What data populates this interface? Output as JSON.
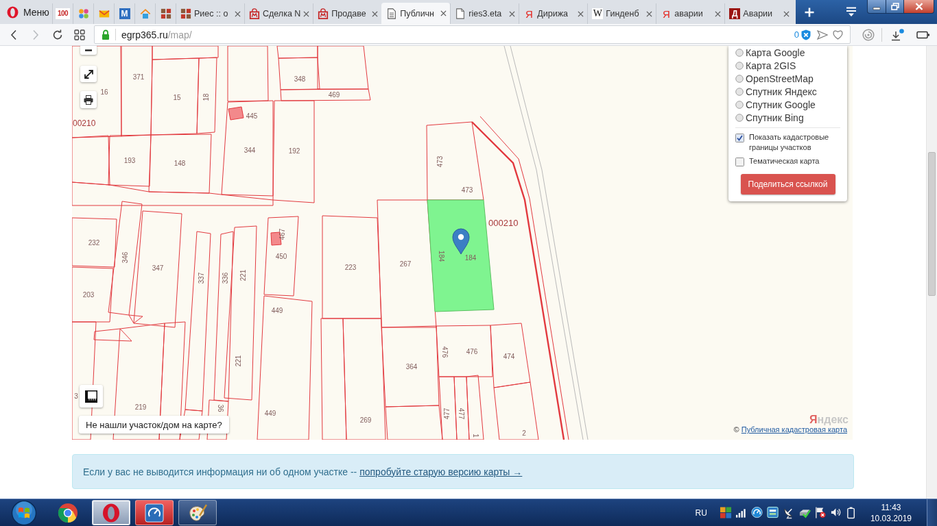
{
  "browser": {
    "menu": "Меню",
    "tabs": [
      {
        "icon_text": "100",
        "selected": false
      },
      {
        "selected": false
      },
      {
        "selected": false
      },
      {
        "icon_text": "M",
        "selected": false
      },
      {
        "selected": false
      },
      {
        "selected": false
      },
      {
        "label": "Риес :: о",
        "selected": false
      },
      {
        "label": "Сделка N",
        "selected": false
      },
      {
        "label": "Продаве",
        "selected": false
      },
      {
        "label": "Публичн",
        "selected": true
      },
      {
        "label": "ries3.eta",
        "selected": false
      },
      {
        "icon_text": "Я",
        "label": "Дирижа",
        "selected": false
      },
      {
        "icon_text": "W",
        "label": "Гинденб",
        "selected": false
      },
      {
        "icon_text": "Я",
        "label": "аварии",
        "selected": false
      },
      {
        "icon_text": "Д",
        "label": "Аварии",
        "selected": false
      }
    ],
    "address": {
      "host": "egrp365.ru",
      "path": "/map/"
    },
    "blocked_count": "0"
  },
  "map": {
    "quarter_labels": [
      "00210",
      "000210"
    ],
    "parcels": [
      {
        "kind": "land",
        "labels": [
          "16"
        ],
        "selected": false
      },
      {
        "kind": "land",
        "labels": [
          "371"
        ],
        "selected": false
      },
      {
        "kind": "land",
        "labels": [
          "15"
        ],
        "selected": false
      },
      {
        "kind": "land",
        "labels": [
          "18"
        ],
        "selected": false
      },
      {
        "kind": "land",
        "labels": [
          "348"
        ],
        "selected": false
      },
      {
        "kind": "land",
        "labels": [
          "469"
        ],
        "selected": false
      },
      {
        "kind": "building",
        "labels": [
          "445"
        ],
        "selected": false
      },
      {
        "kind": "land",
        "labels": [
          "344"
        ],
        "selected": false
      },
      {
        "kind": "land",
        "labels": [
          "192"
        ],
        "selected": false
      },
      {
        "kind": "land",
        "labels": [
          "193"
        ],
        "selected": false
      },
      {
        "kind": "land",
        "labels": [
          "148"
        ],
        "selected": false
      },
      {
        "kind": "land",
        "labels": [
          "473",
          "473"
        ],
        "selected": false
      },
      {
        "kind": "land",
        "labels": [
          "232"
        ],
        "selected": false
      },
      {
        "kind": "land",
        "labels": [
          "346"
        ],
        "selected": false
      },
      {
        "kind": "land",
        "labels": [
          "347"
        ],
        "selected": false
      },
      {
        "kind": "land",
        "labels": [
          "337"
        ],
        "selected": false
      },
      {
        "kind": "land",
        "labels": [
          "336"
        ],
        "selected": false
      },
      {
        "kind": "land",
        "labels": [
          "221",
          "221"
        ],
        "selected": false
      },
      {
        "kind": "building",
        "labels": [
          "467"
        ],
        "selected": false
      },
      {
        "kind": "land",
        "labels": [
          "450"
        ],
        "selected": false
      },
      {
        "kind": "land",
        "labels": [
          "223"
        ],
        "selected": false
      },
      {
        "kind": "land",
        "labels": [
          "267"
        ],
        "selected": false
      },
      {
        "kind": "land",
        "labels": [
          "184",
          "184"
        ],
        "selected": true
      },
      {
        "kind": "land",
        "labels": [
          "203"
        ],
        "selected": false
      },
      {
        "kind": "land",
        "labels": [
          "449",
          "449"
        ],
        "selected": false
      },
      {
        "kind": "land",
        "labels": [
          "476",
          "476"
        ],
        "selected": false
      },
      {
        "kind": "land",
        "labels": [
          "474"
        ],
        "selected": false
      },
      {
        "kind": "land",
        "labels": [
          "364"
        ],
        "selected": false
      },
      {
        "kind": "land",
        "labels": [
          "3"
        ],
        "selected": false
      },
      {
        "kind": "land",
        "labels": [
          "219"
        ],
        "selected": false
      },
      {
        "kind": "land",
        "labels": [
          "36"
        ],
        "selected": false
      },
      {
        "kind": "land",
        "labels": [
          "269"
        ],
        "selected": false
      },
      {
        "kind": "land",
        "labels": [
          "477"
        ],
        "selected": false
      },
      {
        "kind": "land",
        "labels": [
          "477"
        ],
        "selected": false
      },
      {
        "kind": "land",
        "labels": [
          "1"
        ],
        "selected": false
      },
      {
        "kind": "land",
        "labels": [
          "2"
        ],
        "selected": false
      }
    ],
    "layers": [
      {
        "label": "Карта Google",
        "selected": false
      },
      {
        "label": "Карта 2GIS",
        "selected": false
      },
      {
        "label": "OpenStreetMap",
        "selected": false
      },
      {
        "label": "Спутник Яндекс",
        "selected": false
      },
      {
        "label": "Спутник Google",
        "selected": false
      },
      {
        "label": "Спутник Bing",
        "selected": false
      }
    ],
    "options": [
      {
        "label": "Показать кадастровые границы участков",
        "checked": true
      },
      {
        "label": "Тематическая карта",
        "checked": false
      }
    ],
    "share_button": "Поделиться ссылкой",
    "missing_button": "Не нашли участок/дом на карте?",
    "provider_logo": "Яндекс",
    "attribution": {
      "prefix": "©",
      "link": "Публичная кадастровая карта"
    }
  },
  "notice": {
    "text": "Если у вас не выводится информация ни об одном участке -- ",
    "link": "попробуйте старую версию карты →"
  },
  "taskbar": {
    "apps": [
      {
        "running": false,
        "selected": false,
        "flashing": false
      },
      {
        "running": true,
        "selected": true,
        "flashing": false
      },
      {
        "running": true,
        "selected": false,
        "flashing": true
      },
      {
        "running": true,
        "selected": false,
        "flashing": false
      }
    ],
    "language": "RU",
    "time": "11:43",
    "date": "10.03.2019"
  }
}
